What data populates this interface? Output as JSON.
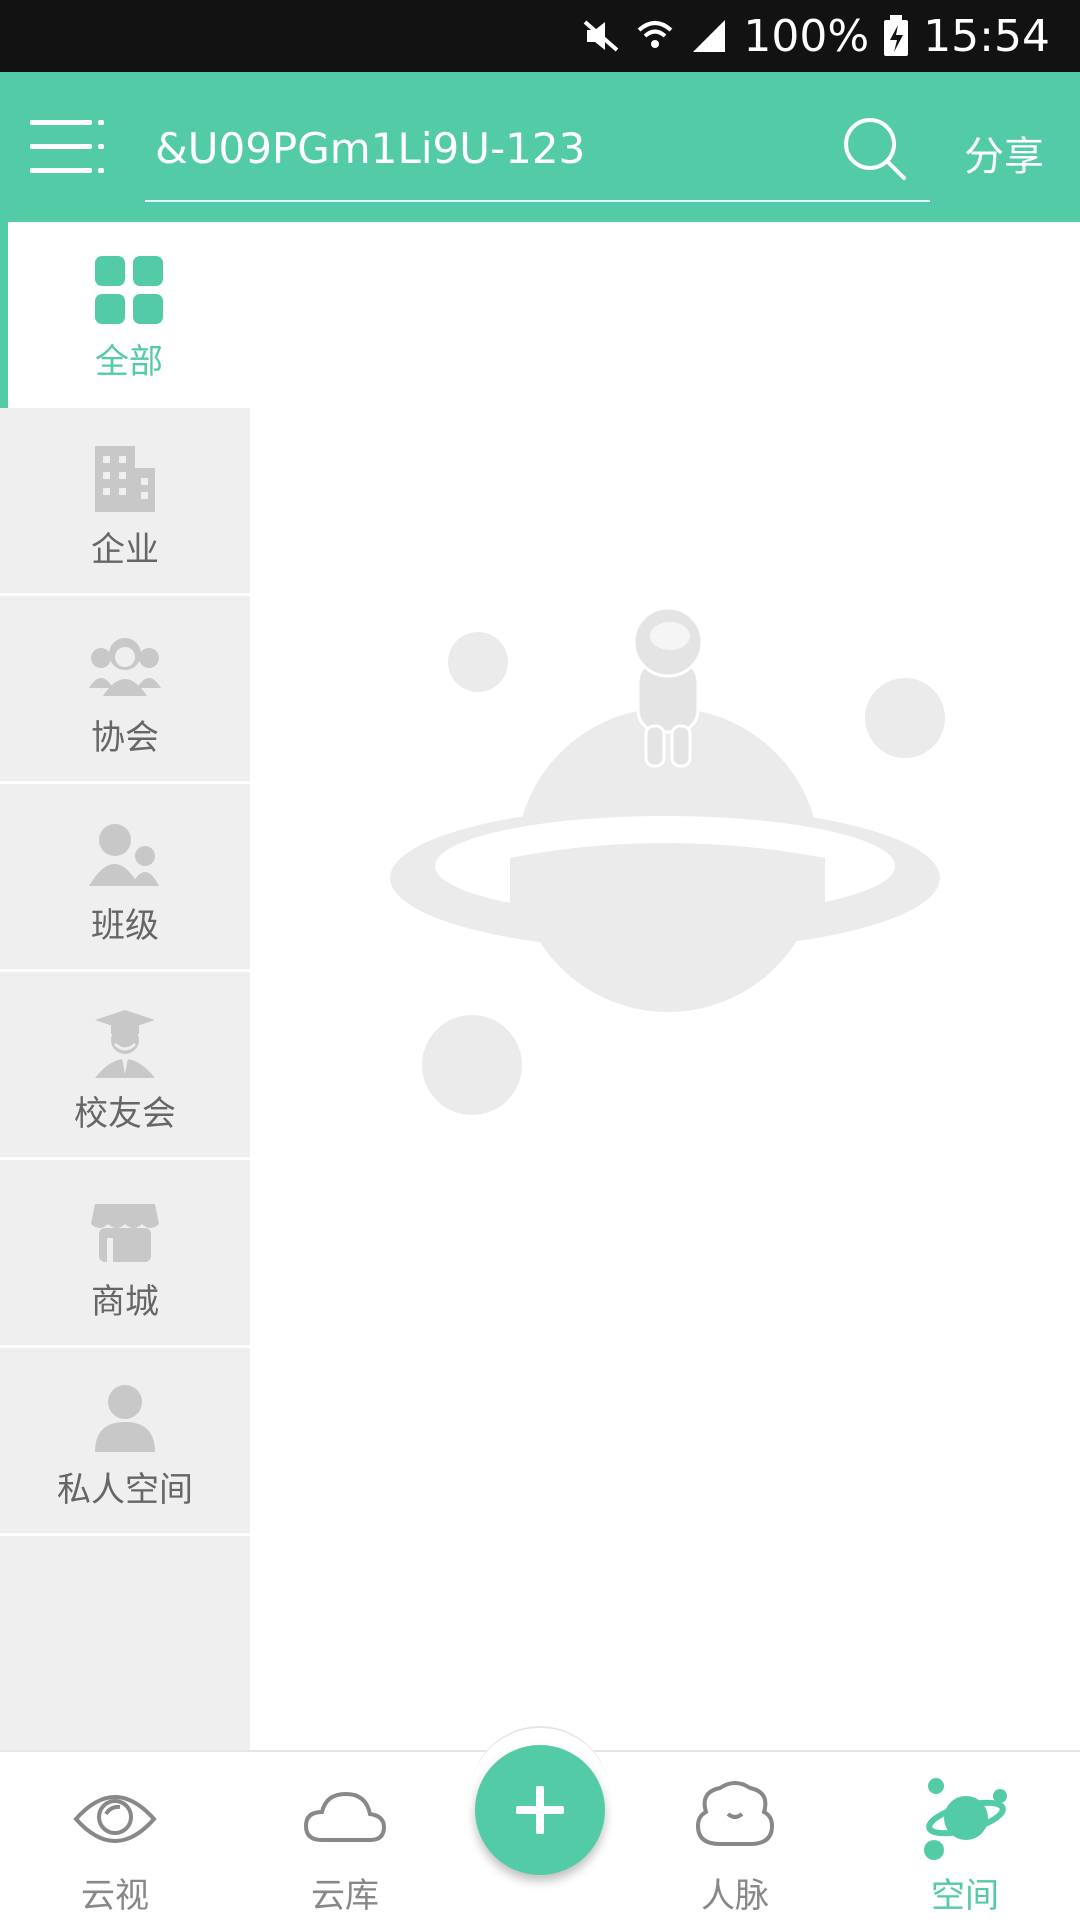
{
  "status_bar": {
    "battery": "100%",
    "time": "15:54"
  },
  "header": {
    "search_value": "&U09PGm1Li9U-123",
    "share_label": "分享"
  },
  "sidebar": {
    "items": [
      {
        "label": "全部",
        "icon": "grid-icon",
        "active": true
      },
      {
        "label": "企业",
        "icon": "building-icon"
      },
      {
        "label": "协会",
        "icon": "association-icon"
      },
      {
        "label": "班级",
        "icon": "class-icon"
      },
      {
        "label": "校友会",
        "icon": "alumni-icon"
      },
      {
        "label": "商城",
        "icon": "shop-icon"
      },
      {
        "label": "私人空间",
        "icon": "person-icon"
      }
    ]
  },
  "bottom_nav": {
    "items": [
      {
        "label": "云视",
        "icon": "eye-icon"
      },
      {
        "label": "云库",
        "icon": "cloud-icon"
      },
      {
        "label": "",
        "icon": "add-icon"
      },
      {
        "label": "人脉",
        "icon": "contacts-icon"
      },
      {
        "label": "空间",
        "icon": "planet-icon",
        "active": true
      }
    ]
  },
  "colors": {
    "accent": "#53cba7",
    "status_bar": "#121212",
    "sidebar_bg": "#efefef",
    "text_muted": "#666666"
  }
}
